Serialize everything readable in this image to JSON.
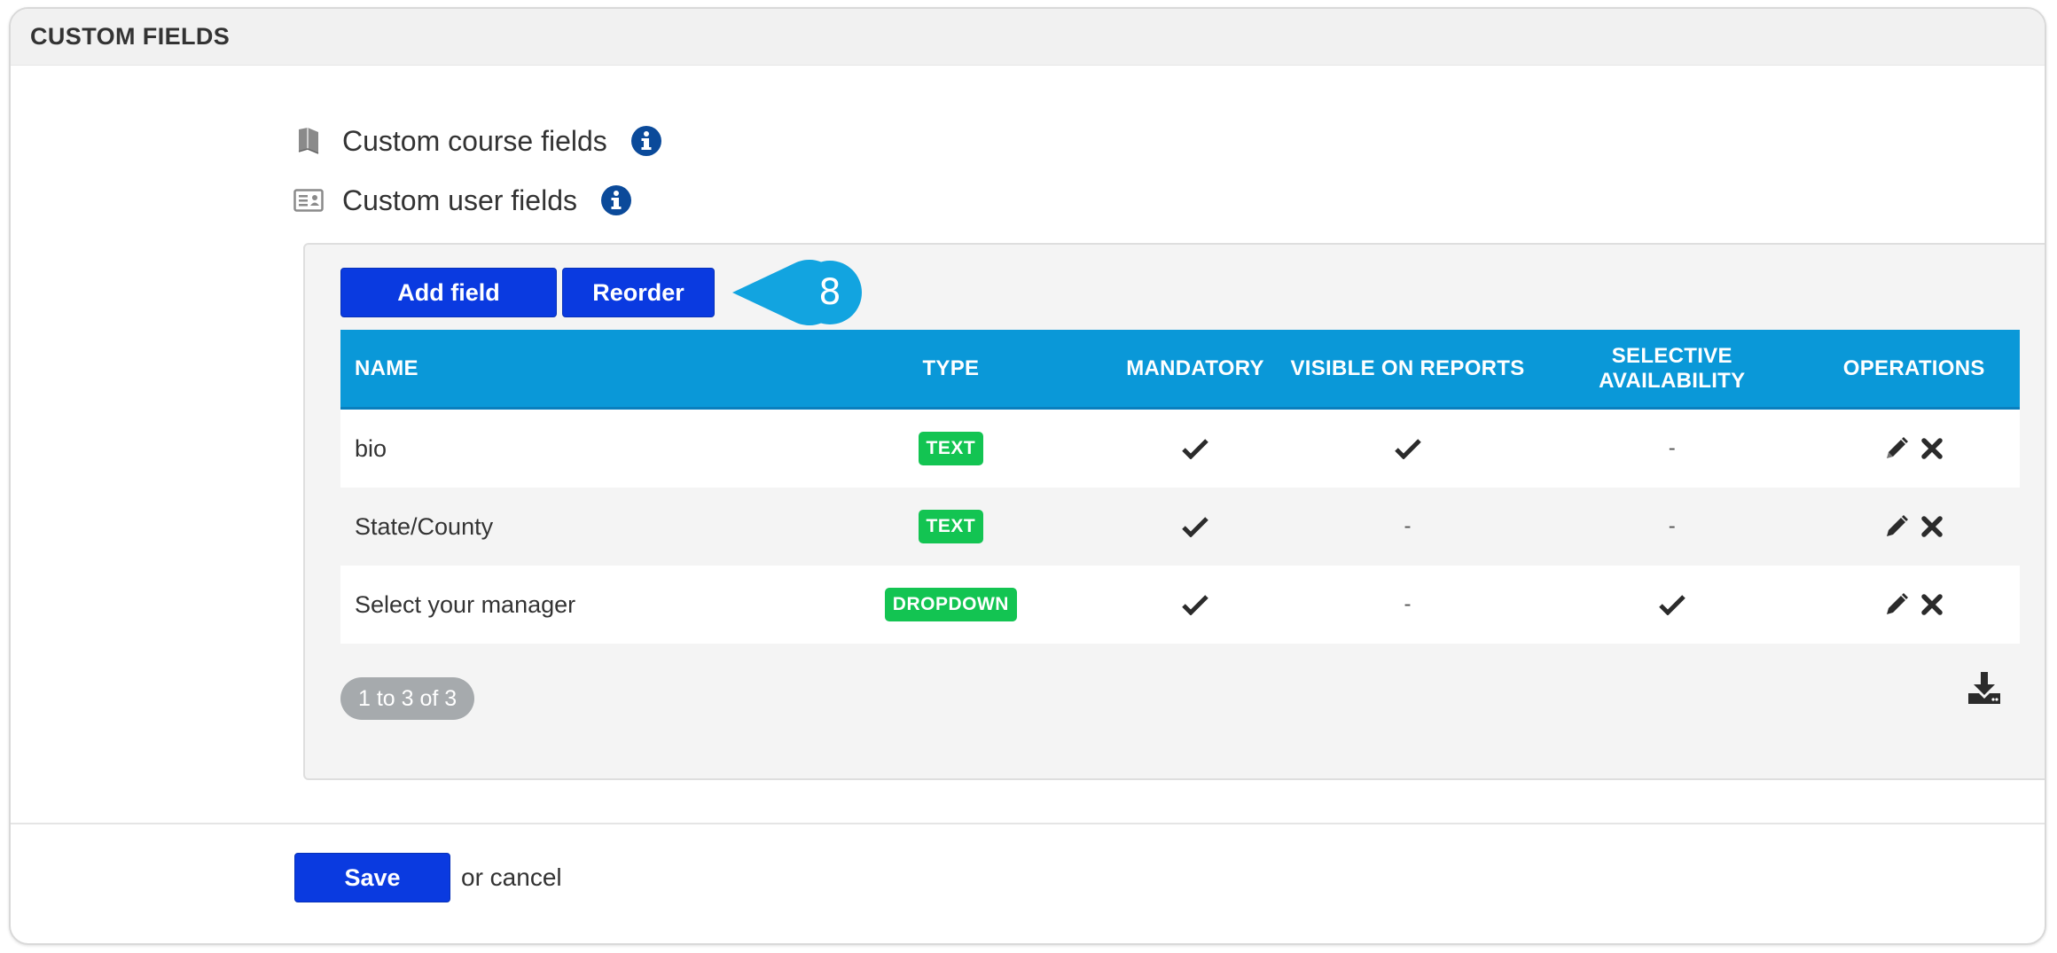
{
  "panel": {
    "title": "CUSTOM FIELDS"
  },
  "links": {
    "course": {
      "label": "Custom course fields",
      "icon": "book-icon"
    },
    "user": {
      "label": "Custom user fields",
      "icon": "id-card-icon"
    }
  },
  "toolbar": {
    "add_label": "Add field",
    "reorder_label": "Reorder"
  },
  "callout": {
    "number": "8",
    "color": "#12a4e0"
  },
  "table": {
    "headers": [
      "NAME",
      "TYPE",
      "MANDATORY",
      "VISIBLE ON REPORTS",
      "SELECTIVE AVAILABILITY",
      "OPERATIONS"
    ],
    "rows": [
      {
        "name": "bio",
        "type": "TEXT",
        "mandatory": true,
        "visible": true,
        "selective": false
      },
      {
        "name": "State/County",
        "type": "TEXT",
        "mandatory": true,
        "visible": false,
        "selective": false
      },
      {
        "name": "Select your manager",
        "type": "DROPDOWN",
        "mandatory": true,
        "visible": false,
        "selective": true
      }
    ],
    "empty_mark": "-"
  },
  "pager": {
    "text": "1 to 3 of 3"
  },
  "footer": {
    "save_label": "Save",
    "cancel_text": "or cancel"
  },
  "colors": {
    "primary_button": "#0a3ae0",
    "table_header": "#0a98d8",
    "badge": "#13c452",
    "info_icon": "#0b4a9a",
    "pager": "#a6aaad"
  }
}
